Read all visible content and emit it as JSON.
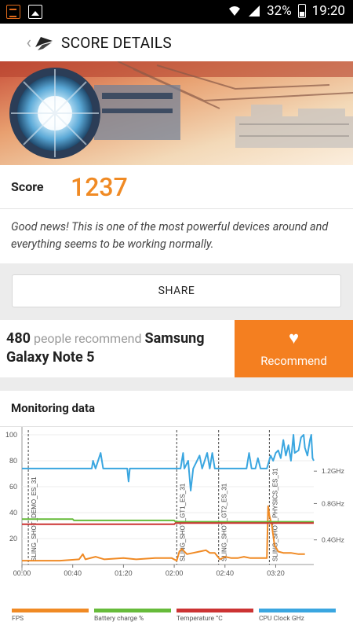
{
  "status_bar": {
    "battery": "32%",
    "time": "19:20",
    "icons": [
      "app-icon",
      "image-icon",
      "wifi-icon",
      "signal-icon",
      "battery-icon"
    ]
  },
  "app_bar": {
    "back_icon": "chevron-left-icon",
    "logo_icon": "3dmark-icon",
    "title": "SCORE DETAILS"
  },
  "score": {
    "label": "Score",
    "value": "1237",
    "message": "Good news! This is one of the most powerful devices around and everything seems to be working normally."
  },
  "share": {
    "label": "SHARE"
  },
  "recommend": {
    "count": "480",
    "middle_text": " people recommend ",
    "device": "Samsung Galaxy Note 5",
    "button_icon": "heart-icon",
    "button_label": "Recommend"
  },
  "monitoring": {
    "title": "Monitoring data"
  },
  "chart_data": {
    "type": "line",
    "x_ticks": [
      "00:00",
      "00:40",
      "01:20",
      "02:00",
      "02:40",
      "03:20"
    ],
    "y_ticks_left": [
      "100",
      "80",
      "60",
      "40",
      "20"
    ],
    "y_ticks_right": [
      "1.2GHz",
      "0.8GHz",
      "0.4GHz"
    ],
    "ylim": [
      0,
      100
    ],
    "xlim_seconds": [
      0,
      230
    ],
    "segments": [
      {
        "label": "SLING_SHOT_DEMO_ES_31",
        "start": 5
      },
      {
        "label": "SLING_SHOT_GT1_ES_31",
        "start": 122
      },
      {
        "label": "SLING_SHOT_GT2_ES_31",
        "start": 155
      },
      {
        "label": "SLING_SHOT_PHYSICS_ES_31",
        "start": 195
      }
    ],
    "series": [
      {
        "name": "FPS",
        "color": "#f08a24",
        "points": [
          [
            0,
            3
          ],
          [
            15,
            3
          ],
          [
            30,
            3
          ],
          [
            45,
            4
          ],
          [
            48,
            8
          ],
          [
            50,
            4
          ],
          [
            58,
            6
          ],
          [
            65,
            4
          ],
          [
            80,
            5
          ],
          [
            90,
            4
          ],
          [
            105,
            5
          ],
          [
            118,
            5
          ],
          [
            122,
            3
          ],
          [
            124,
            10
          ],
          [
            126,
            12
          ],
          [
            130,
            8
          ],
          [
            135,
            9
          ],
          [
            140,
            10
          ],
          [
            145,
            11
          ],
          [
            148,
            9
          ],
          [
            152,
            9
          ],
          [
            156,
            4
          ],
          [
            160,
            6
          ],
          [
            165,
            5
          ],
          [
            170,
            5
          ],
          [
            175,
            6
          ],
          [
            180,
            5
          ],
          [
            185,
            5
          ],
          [
            190,
            5
          ],
          [
            193,
            5
          ],
          [
            194,
            45
          ],
          [
            195,
            38
          ],
          [
            197,
            30
          ],
          [
            199,
            15
          ],
          [
            202,
            10
          ],
          [
            206,
            9
          ],
          [
            212,
            9
          ],
          [
            218,
            8
          ],
          [
            223,
            8
          ]
        ]
      },
      {
        "name": "Battery charge %",
        "color": "#66bb3a",
        "points": [
          [
            0,
            35
          ],
          [
            40,
            35
          ],
          [
            41,
            34
          ],
          [
            120,
            34
          ],
          [
            121,
            33
          ],
          [
            230,
            33
          ]
        ]
      },
      {
        "name": "Temperature °C",
        "color": "#cc3333",
        "points": [
          [
            0,
            31
          ],
          [
            120,
            31
          ],
          [
            121,
            32
          ],
          [
            230,
            32
          ]
        ]
      },
      {
        "name": "CPU Clock GHz",
        "color": "#3aa6e0",
        "points": [
          [
            0,
            74
          ],
          [
            55,
            74
          ],
          [
            56,
            80
          ],
          [
            58,
            74
          ],
          [
            62,
            86
          ],
          [
            64,
            74
          ],
          [
            81,
            74
          ],
          [
            83,
            74
          ],
          [
            84,
            64
          ],
          [
            85,
            74
          ],
          [
            125,
            74
          ],
          [
            127,
            86
          ],
          [
            128,
            74
          ],
          [
            131,
            80
          ],
          [
            133,
            57
          ],
          [
            135,
            74
          ],
          [
            140,
            84
          ],
          [
            142,
            74
          ],
          [
            146,
            86
          ],
          [
            148,
            74
          ],
          [
            150,
            86
          ],
          [
            152,
            74
          ],
          [
            177,
            74
          ],
          [
            179,
            86
          ],
          [
            181,
            74
          ],
          [
            184,
            74
          ],
          [
            186,
            82
          ],
          [
            188,
            74
          ],
          [
            193,
            74
          ],
          [
            196,
            84
          ],
          [
            198,
            80
          ],
          [
            200,
            86
          ],
          [
            202,
            88
          ],
          [
            204,
            82
          ],
          [
            206,
            96
          ],
          [
            208,
            84
          ],
          [
            210,
            92
          ],
          [
            212,
            80
          ],
          [
            214,
            100
          ],
          [
            215,
            86
          ],
          [
            218,
            88
          ],
          [
            220,
            98
          ],
          [
            222,
            100
          ],
          [
            223,
            90
          ],
          [
            225,
            84
          ],
          [
            227,
            96
          ],
          [
            228,
            100
          ],
          [
            229,
            82
          ],
          [
            230,
            80
          ]
        ]
      }
    ]
  }
}
